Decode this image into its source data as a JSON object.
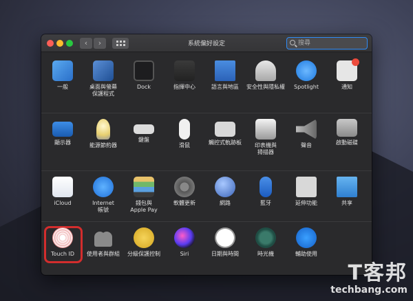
{
  "window": {
    "title": "系統偏好設定",
    "search_placeholder": "搜尋",
    "back_icon": "chevron-left-icon",
    "forward_icon": "chevron-right-icon"
  },
  "rows": [
    [
      {
        "label": "一般",
        "icon": "general-icon"
      },
      {
        "label": "桌面與螢幕\n保護程式",
        "icon": "desktop-icon"
      },
      {
        "label": "Dock",
        "icon": "dock-icon"
      },
      {
        "label": "指揮中心",
        "icon": "mission-control-icon"
      },
      {
        "label": "語言與地區",
        "icon": "language-icon"
      },
      {
        "label": "安全性與隱私權",
        "icon": "security-icon"
      },
      {
        "label": "Spotlight",
        "icon": "spotlight-icon"
      },
      {
        "label": "通知",
        "icon": "notifications-icon"
      }
    ],
    [
      {
        "label": "顯示器",
        "icon": "display-icon"
      },
      {
        "label": "能源節約器",
        "icon": "energy-icon"
      },
      {
        "label": "鍵盤",
        "icon": "keyboard-icon"
      },
      {
        "label": "滑鼠",
        "icon": "mouse-icon"
      },
      {
        "label": "觸控式軌跡板",
        "icon": "trackpad-icon"
      },
      {
        "label": "印表機與\n掃描器",
        "icon": "printer-icon"
      },
      {
        "label": "聲音",
        "icon": "sound-icon"
      },
      {
        "label": "啟動磁碟",
        "icon": "disk-icon"
      }
    ],
    [
      {
        "label": "iCloud",
        "icon": "icloud-icon"
      },
      {
        "label": "Internet\n帳號",
        "icon": "internet-accounts-icon"
      },
      {
        "label": "錢包與\nApple Pay",
        "icon": "wallet-icon"
      },
      {
        "label": "軟體更新",
        "icon": "software-update-icon"
      },
      {
        "label": "網路",
        "icon": "network-icon"
      },
      {
        "label": "藍牙",
        "icon": "bluetooth-icon"
      },
      {
        "label": "延伸功能",
        "icon": "extensions-icon"
      },
      {
        "label": "共享",
        "icon": "sharing-icon"
      }
    ],
    [
      {
        "label": "Touch ID",
        "icon": "touch-id-icon"
      },
      {
        "label": "使用者與群組",
        "icon": "users-icon"
      },
      {
        "label": "分級保護控制",
        "icon": "parental-icon"
      },
      {
        "label": "Siri",
        "icon": "siri-icon"
      },
      {
        "label": "日期與時間",
        "icon": "datetime-icon"
      },
      {
        "label": "時光機",
        "icon": "time-machine-icon"
      },
      {
        "label": "輔助使用",
        "icon": "accessibility-icon"
      }
    ]
  ],
  "watermark": {
    "logo": "T客邦",
    "sub": "techbang.com"
  },
  "colors": {
    "highlight": "#d32d2d",
    "search_focus": "#2f8cf7"
  }
}
